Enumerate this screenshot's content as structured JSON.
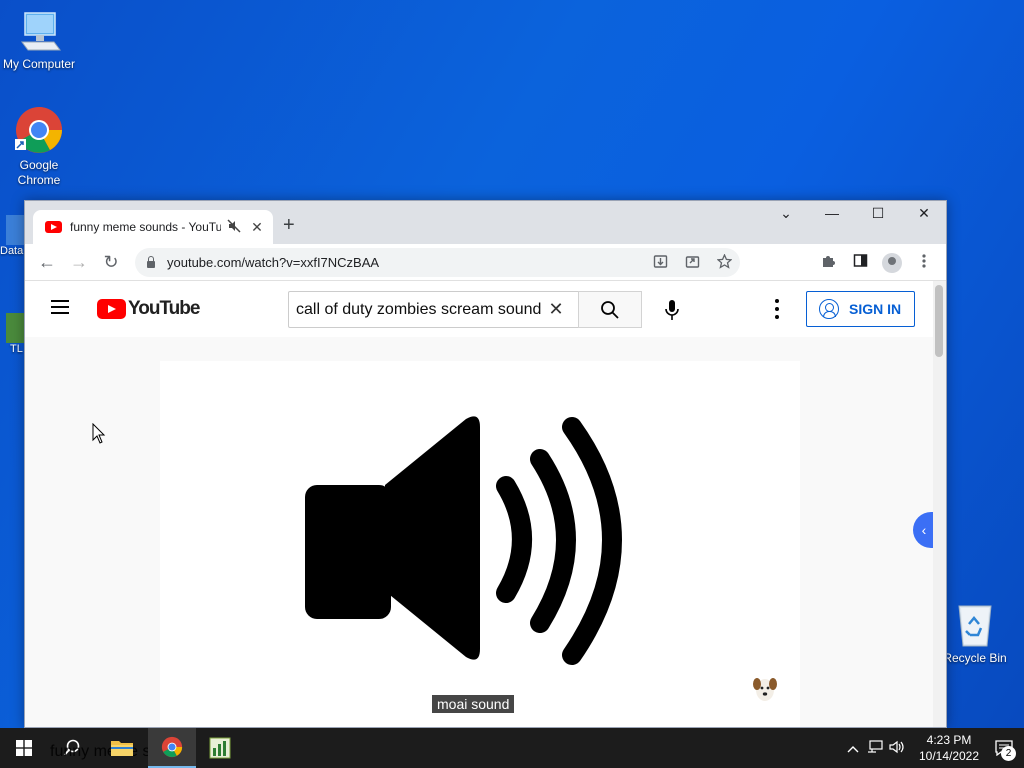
{
  "desktop": {
    "icons": [
      {
        "name": "my-computer",
        "label": "My Computer"
      },
      {
        "name": "google-chrome",
        "label": "Google Chrome"
      },
      {
        "name": "recycle-bin",
        "label": "Recycle Bin"
      }
    ],
    "partial_icons": [
      "Data",
      "TL"
    ]
  },
  "browser": {
    "tab": {
      "title": "funny meme sounds - YouTube",
      "close": "✕",
      "new": "+"
    },
    "window_controls": {
      "tab_search": "⌄",
      "minimize": "—",
      "maximize": "☐",
      "close": "✕"
    },
    "nav": {
      "back": "←",
      "forward": "→",
      "reload": "↻"
    },
    "url": "youtube.com/watch?v=xxfI7NCzBAA",
    "colors": {
      "tabstrip": "#dee1e6",
      "omnibox": "#f1f3f4"
    }
  },
  "youtube": {
    "logo_text": "YouTube",
    "search_value": "call of duty zombies scream sound",
    "clear": "✕",
    "sign_in": "SIGN IN",
    "caption": "moai sound",
    "side_arrow": "‹",
    "colors": {
      "brand": "#ff0000",
      "signin": "#065fd4"
    }
  },
  "taskbar": {
    "ghost_text": "funny meme sounds",
    "clock_time": "4:23 PM",
    "clock_date": "10/14/2022",
    "notifications": "2",
    "tray_icons": [
      "chevron-up-icon",
      "network-icon",
      "volume-icon"
    ]
  }
}
